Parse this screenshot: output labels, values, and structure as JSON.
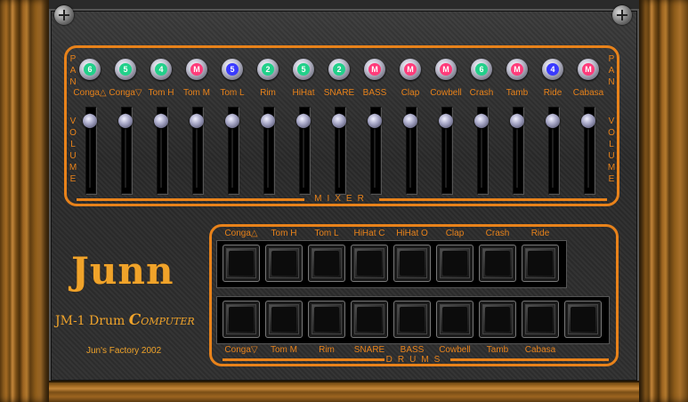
{
  "mixer": {
    "pan_label": "PAN",
    "volume_label": "VOLUME",
    "title": "MIXER",
    "channels": [
      {
        "label": "Conga△",
        "pan": "6",
        "pan_color": "#22d08a"
      },
      {
        "label": "Conga▽",
        "pan": "5",
        "pan_color": "#22d08a"
      },
      {
        "label": "Tom H",
        "pan": "4",
        "pan_color": "#22d08a"
      },
      {
        "label": "Tom M",
        "pan": "M",
        "pan_color": "#ff3b7a"
      },
      {
        "label": "Tom L",
        "pan": "5",
        "pan_color": "#3a3aff"
      },
      {
        "label": "Rim",
        "pan": "2",
        "pan_color": "#22d08a"
      },
      {
        "label": "HiHat",
        "pan": "5",
        "pan_color": "#22d08a"
      },
      {
        "label": "SNARE",
        "pan": "2",
        "pan_color": "#22d08a"
      },
      {
        "label": "BASS",
        "pan": "M",
        "pan_color": "#ff3b7a"
      },
      {
        "label": "Clap",
        "pan": "M",
        "pan_color": "#ff3b7a"
      },
      {
        "label": "Cowbell",
        "pan": "M",
        "pan_color": "#ff3b7a"
      },
      {
        "label": "Crash",
        "pan": "6",
        "pan_color": "#22d08a"
      },
      {
        "label": "Tamb",
        "pan": "M",
        "pan_color": "#ff3b7a"
      },
      {
        "label": "Ride",
        "pan": "4",
        "pan_color": "#3a3aff"
      },
      {
        "label": "Cabasa",
        "pan": "M",
        "pan_color": "#ff3b7a"
      }
    ]
  },
  "brand": {
    "logo": "Junn",
    "model_prefix": "JM-1 Drum ",
    "model_c": "C",
    "model_rest": "OMPUTER",
    "factory": "Jun's Factory 2002"
  },
  "drums": {
    "title": "DRUMS",
    "top_row": [
      "Conga△",
      "Tom H",
      "Tom L",
      "HiHat C",
      "HiHat O",
      "Clap",
      "Crash",
      "Ride"
    ],
    "bottom_row": [
      "Conga▽",
      "Tom M",
      "Rim",
      "SNARE",
      "BASS",
      "Cowbell",
      "Tamb",
      "Cabasa",
      ""
    ]
  },
  "colors": {
    "accent": "#e8821a",
    "logo": "#f0a32a"
  }
}
